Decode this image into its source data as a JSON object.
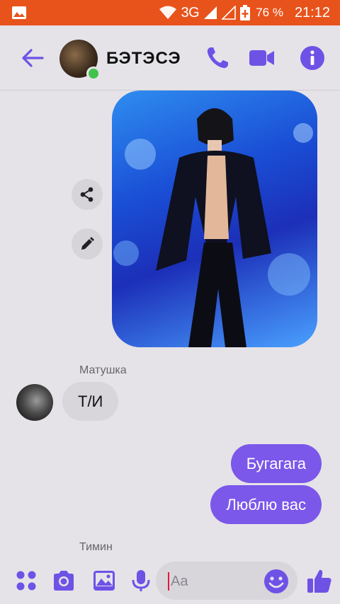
{
  "status_bar": {
    "network": "3G",
    "battery": "76 %",
    "time": "21:12",
    "background_color": "#e8531c"
  },
  "header": {
    "title": "БЭТЭСЭ",
    "online": true,
    "accent_color": "#6e52e6"
  },
  "messages": {
    "photo_icons": [
      "share-icon",
      "pencil-icon"
    ],
    "incoming": {
      "sender": "Матушка",
      "text": "Т/И"
    },
    "outgoing": [
      {
        "text": "Бугагага"
      },
      {
        "text": "Люблю вас"
      }
    ],
    "next_sender": "Тимин",
    "outgoing_bubble_color": "#7b57ea"
  },
  "composer": {
    "placeholder": "Aa",
    "icons": [
      "apps-icon",
      "camera-icon",
      "gallery-icon",
      "mic-icon",
      "emoji-icon",
      "thumbs-up-icon"
    ]
  }
}
